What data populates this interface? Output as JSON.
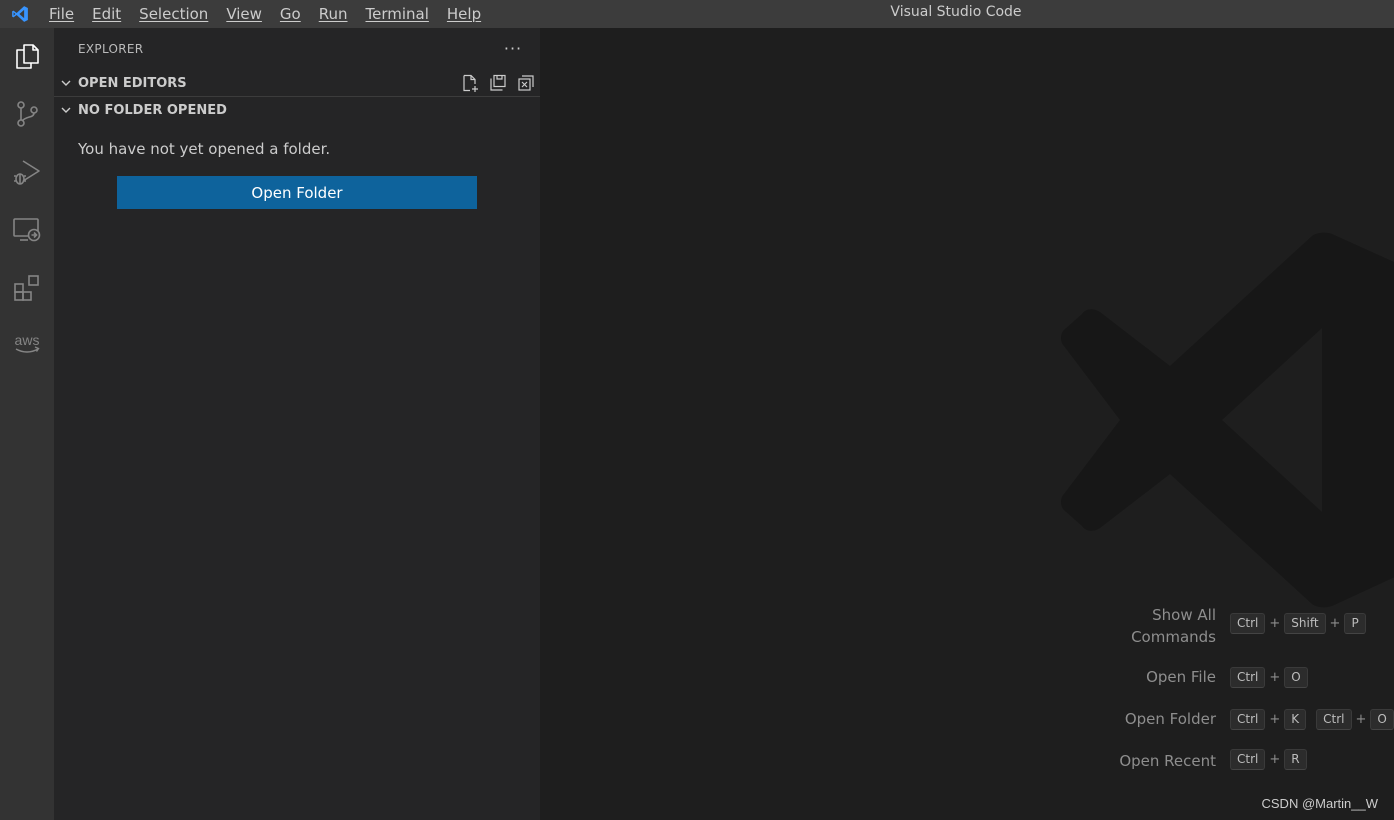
{
  "window": {
    "title": "Visual Studio Code"
  },
  "menubar": {
    "items": [
      "File",
      "Edit",
      "Selection",
      "View",
      "Go",
      "Run",
      "Terminal",
      "Help"
    ]
  },
  "activitybar": {
    "items": [
      {
        "icon": "files-icon"
      },
      {
        "icon": "source-control-icon"
      },
      {
        "icon": "run-debug-icon"
      },
      {
        "icon": "remote-explorer-icon"
      },
      {
        "icon": "extensions-icon"
      },
      {
        "icon": "aws-icon",
        "text": "aws"
      }
    ]
  },
  "sidebar": {
    "header": "EXPLORER",
    "more_label": "···",
    "open_editors": {
      "label": "OPEN EDITORS"
    },
    "no_folder": {
      "label": "NO FOLDER OPENED",
      "message": "You have not yet opened a folder.",
      "button": "Open Folder"
    }
  },
  "editor": {
    "shortcuts": [
      {
        "label_line1": "Show All",
        "label_line2": "Commands",
        "keys": [
          [
            "Ctrl",
            "Shift",
            "P"
          ]
        ]
      },
      {
        "label_line1": "Open File",
        "keys": [
          [
            "Ctrl",
            "O"
          ]
        ]
      },
      {
        "label_line1": "Open Folder",
        "keys": [
          [
            "Ctrl",
            "K"
          ],
          [
            "Ctrl",
            "O"
          ]
        ]
      },
      {
        "label_line1": "Open Recent",
        "keys": [
          [
            "Ctrl",
            "R"
          ]
        ]
      }
    ],
    "plus": "+",
    "credit": "CSDN @Martin__W"
  },
  "colors": {
    "accent_button": "#0e639c",
    "vscode_blue": "#3794ff",
    "titlebar": "#3c3c3c",
    "activitybar": "#333333",
    "sidebar": "#252526",
    "editor": "#1e1e1e"
  }
}
